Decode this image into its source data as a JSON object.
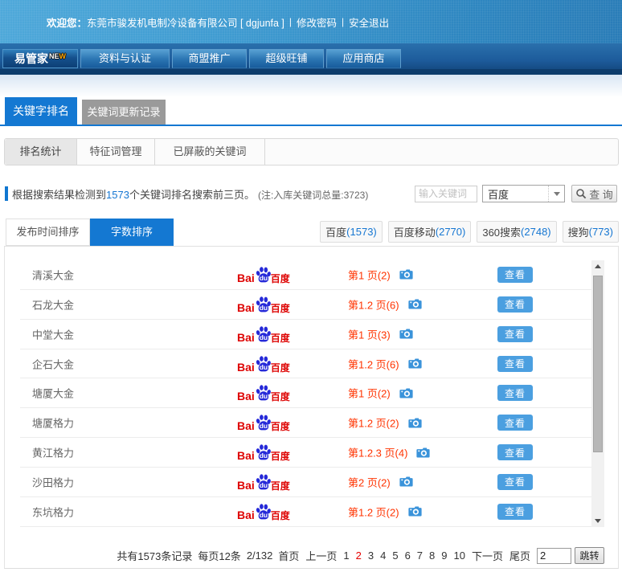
{
  "topbar": {
    "welcome_label": "欢迎您：",
    "company": "东莞市骏发机电制冷设备有限公司 [ dgjunfa ]",
    "sep": "|",
    "change_password": "修改密码",
    "logout": "安全退出"
  },
  "nav": {
    "tabs": [
      {
        "label": "易管家",
        "badge_ne": "NE",
        "badge_w": "W",
        "active": true
      },
      {
        "label": "资料与认证"
      },
      {
        "label": "商盟推广"
      },
      {
        "label": "超级旺铺"
      },
      {
        "label": "应用商店"
      }
    ]
  },
  "page_tabs": [
    {
      "label": "关键字排名",
      "active": true
    },
    {
      "label": "关键词更新记录"
    }
  ],
  "sub_tabs": [
    {
      "label": "排名统计",
      "active": true
    },
    {
      "label": "特征词管理"
    },
    {
      "label": "已屏蔽的关键词"
    }
  ],
  "summary": {
    "prefix": "根据搜索结果检测到",
    "count": "1573",
    "suffix": "个关键词排名搜索前三页。",
    "note": "(注:入库关键词总量:3723)"
  },
  "search": {
    "placeholder": "输入关键词",
    "engine_selected": "百度",
    "button_label": "查 询"
  },
  "sort_tabs": [
    {
      "label": "发布时间排序"
    },
    {
      "label": "字数排序",
      "active": true
    }
  ],
  "engine_counts": [
    {
      "name": "百度",
      "count": "(1573)"
    },
    {
      "name": "百度移动",
      "count": "(2770)"
    },
    {
      "name": "360搜索",
      "count": "(2748)"
    },
    {
      "name": "搜狗",
      "count": "(773)"
    }
  ],
  "baidu_logo": {
    "bai": "Bai",
    "du": "du",
    "cn": "百度"
  },
  "table": {
    "view_label": "查看",
    "rows": [
      {
        "keyword": "清溪大金",
        "rank": "第1 页(2)"
      },
      {
        "keyword": "石龙大金",
        "rank": "第1.2 页(6)"
      },
      {
        "keyword": "中堂大金",
        "rank": "第1 页(3)"
      },
      {
        "keyword": "企石大金",
        "rank": "第1.2 页(6)"
      },
      {
        "keyword": "塘厦大金",
        "rank": "第1 页(2)"
      },
      {
        "keyword": "塘厦格力",
        "rank": "第1.2 页(2)"
      },
      {
        "keyword": "黄江格力",
        "rank": "第1.2.3 页(4)"
      },
      {
        "keyword": "沙田格力",
        "rank": "第2 页(2)"
      },
      {
        "keyword": "东坑格力",
        "rank": "第1.2 页(2)"
      }
    ]
  },
  "pagination": {
    "total": "共有1573条记录",
    "per_page": "每页12条",
    "page_info": "2/132",
    "first": "首页",
    "prev": "上一页",
    "pages": [
      "1",
      "2",
      "3",
      "4",
      "5",
      "6",
      "7",
      "8",
      "9",
      "10"
    ],
    "current": "2",
    "next": "下一页",
    "last": "尾页",
    "jump_value": "2",
    "jump_label": "跳转"
  }
}
